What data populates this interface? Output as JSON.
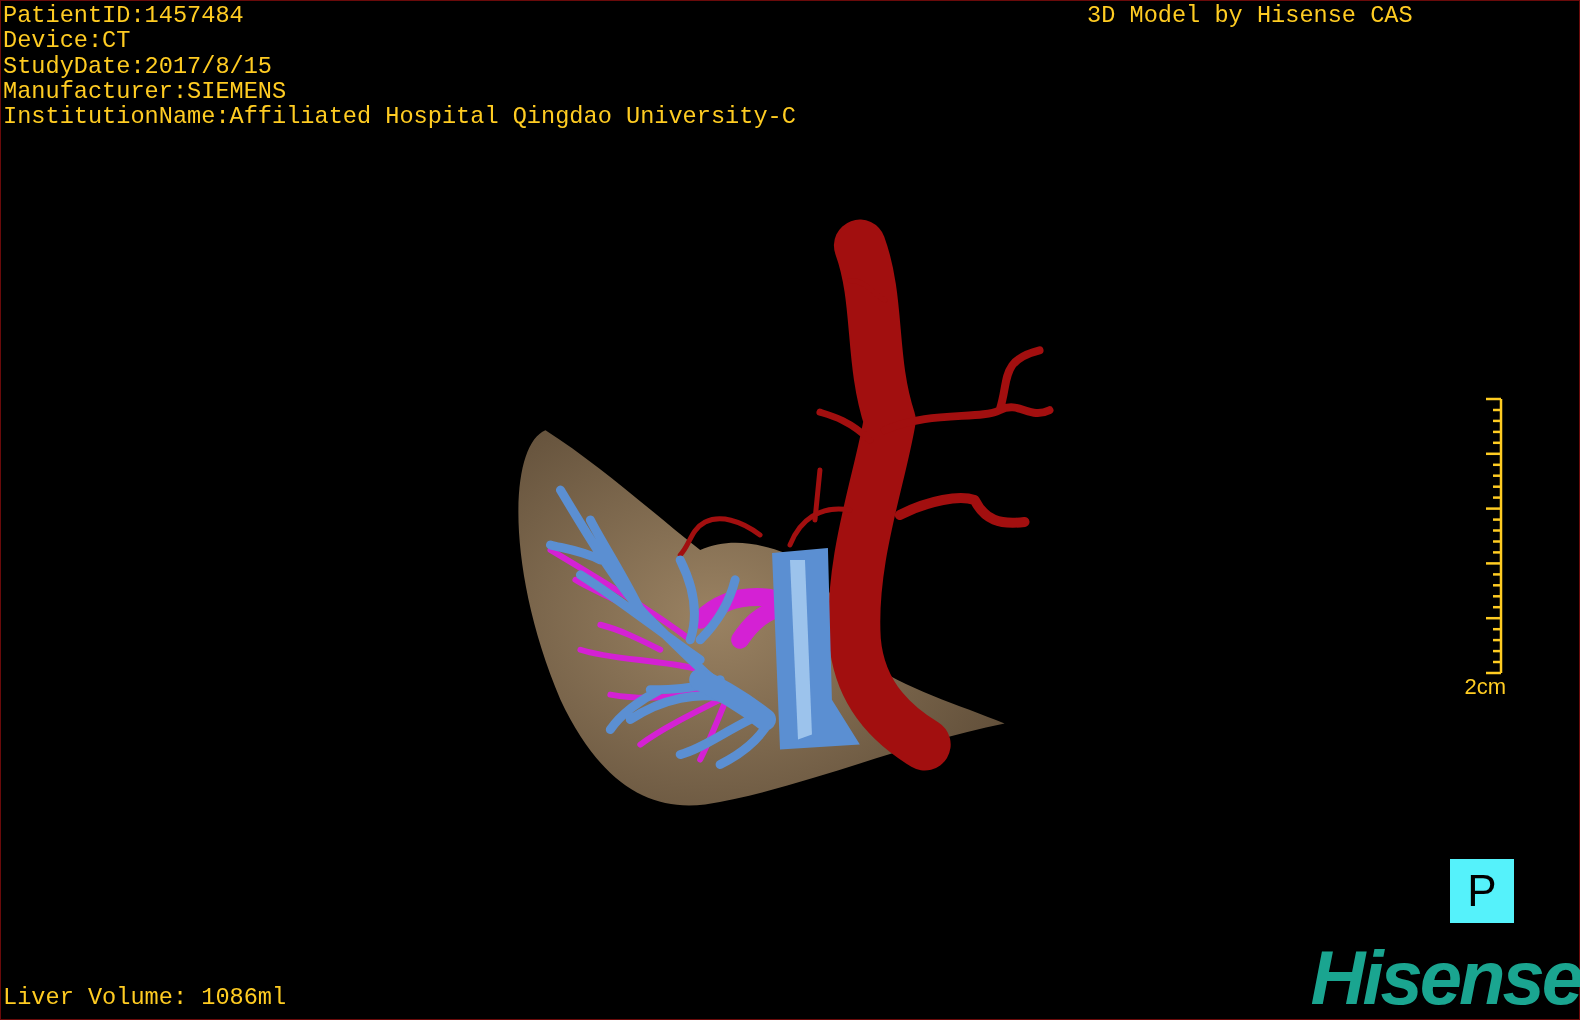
{
  "info_lines": [
    "PatientID:1457484",
    "Device:CT",
    "StudyDate:2017/8/15",
    "Manufacturer:SIEMENS",
    "InstitutionName:Affiliated Hospital Qingdao University-C"
  ],
  "model_credit": "3D Model by Hisense CAS",
  "scale_bar": {
    "label": "2cm"
  },
  "orientation_marker": "P",
  "liver_volume": "Liver Volume: 1086ml",
  "logo": "Hisense"
}
